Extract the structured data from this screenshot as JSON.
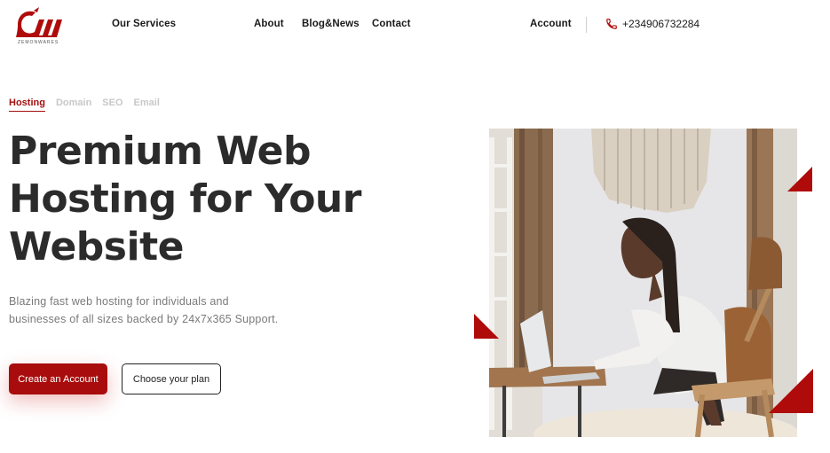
{
  "header": {
    "logo_text": "ZEMONWARES",
    "nav": {
      "services": "Our Services",
      "about": "About",
      "blog": "Blog&News",
      "contact": "Contact",
      "account": "Account"
    },
    "phone": "+234906732284"
  },
  "tabs": [
    "Hosting",
    "Domain",
    "SEO",
    "Email"
  ],
  "hero": {
    "title_lines": [
      "Premium Web",
      "Hosting for Your",
      "Website"
    ],
    "description_lines": [
      "Blazing fast web hosting for individuals and",
      "businesses of all sizes backed by 24x7x365 Support."
    ],
    "primary_button": "Create an Account",
    "secondary_button": "Choose your plan"
  },
  "colors": {
    "accent": "#a80c0c",
    "title": "#2b2b2b",
    "muted": "#7a7a7a",
    "inactive_tab": "#c8c8c8"
  },
  "icons": {
    "phone": "phone-icon",
    "logo": "logo-icon"
  }
}
